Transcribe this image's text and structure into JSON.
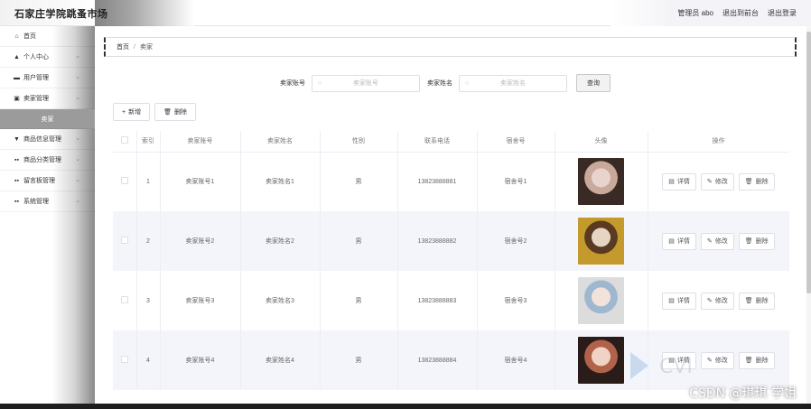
{
  "app": {
    "title": "石家庄学院跳蚤市场",
    "user_label": "管理员 abo",
    "nav_front": "退出到前台",
    "logout": "退出登录"
  },
  "sidebar": {
    "items": [
      {
        "label": "首页",
        "icon": "home-icon",
        "glyph": "⌂",
        "chevron": false
      },
      {
        "label": "个人中心",
        "icon": "person-icon",
        "glyph": "▲",
        "chevron": true
      },
      {
        "label": "用户管理",
        "icon": "user-manage-icon",
        "glyph": "▬",
        "chevron": true
      },
      {
        "label": "卖家管理",
        "icon": "seller-icon",
        "glyph": "▣",
        "chevron": true
      },
      {
        "label": "卖家",
        "icon": "",
        "glyph": "",
        "chevron": false,
        "sub": true
      },
      {
        "label": "商品信息管理",
        "icon": "goods-icon",
        "glyph": "▼",
        "chevron": true
      },
      {
        "label": "商品分类管理",
        "icon": "grid-icon",
        "glyph": "▪▪",
        "chevron": true
      },
      {
        "label": "留言板管理",
        "icon": "grid-icon",
        "glyph": "▪▪",
        "chevron": true
      },
      {
        "label": "系统管理",
        "icon": "grid-icon",
        "glyph": "▪▪",
        "chevron": true
      }
    ]
  },
  "breadcrumb": {
    "home": "首页",
    "sep": "/",
    "current": "卖家"
  },
  "search": {
    "account_label": "卖家账号",
    "account_placeholder": "卖家账号",
    "name_label": "卖家姓名",
    "name_placeholder": "卖家姓名",
    "query_button": "查询"
  },
  "actions": {
    "add": "新增",
    "delete": "删除"
  },
  "table": {
    "headers": [
      "",
      "索引",
      "卖家账号",
      "卖家姓名",
      "性别",
      "联系电话",
      "宿舍号",
      "头像",
      "操作"
    ],
    "rows": [
      {
        "index": "1",
        "account": "卖家账号1",
        "name": "卖家姓名1",
        "gender": "男",
        "phone": "13823888881",
        "dorm": "宿舍号1",
        "avatar_colors": [
          "#3a2a26",
          "#c9a99a",
          "#e8d4cc"
        ]
      },
      {
        "index": "2",
        "account": "卖家账号2",
        "name": "卖家姓名2",
        "gender": "男",
        "phone": "13823888882",
        "dorm": "宿舍号2",
        "avatar_colors": [
          "#c49a2c",
          "#5a3b22",
          "#e7d5c3"
        ]
      },
      {
        "index": "3",
        "account": "卖家账号3",
        "name": "卖家姓名3",
        "gender": "男",
        "phone": "13823888883",
        "dorm": "宿舍号3",
        "avatar_colors": [
          "#dcdcdc",
          "#9fb7cf",
          "#f2e3da"
        ]
      },
      {
        "index": "4",
        "account": "卖家账号4",
        "name": "卖家姓名4",
        "gender": "男",
        "phone": "13823888884",
        "dorm": "宿舍号4",
        "avatar_colors": [
          "#2a1c18",
          "#b0634a",
          "#f0d3c4"
        ]
      }
    ],
    "op_detail": "详情",
    "op_edit": "修改",
    "op_delete": "删除"
  },
  "watermark": "CSDN @琪琪 学姐"
}
